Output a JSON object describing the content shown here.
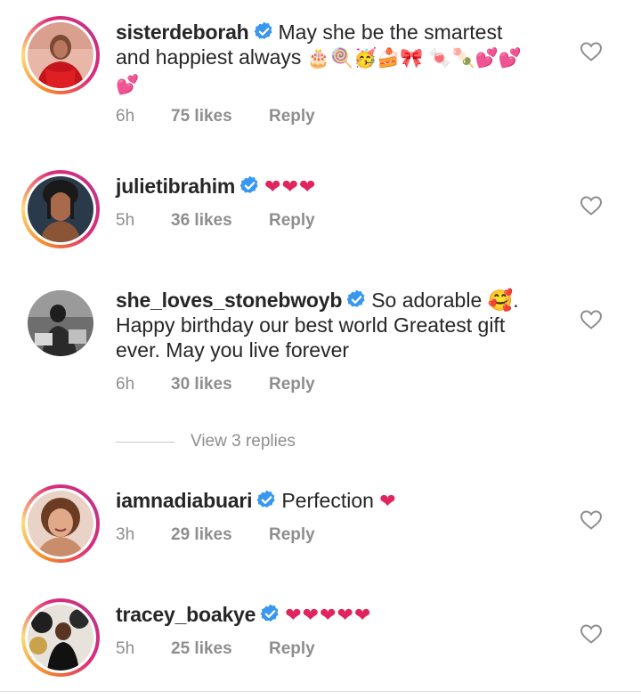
{
  "colors": {
    "text": "#262626",
    "secondary": "#8e8e8e",
    "verified": "#3897f0",
    "heart_red": "#e0245e"
  },
  "comments": [
    {
      "username": "sisterdeborah",
      "verified": true,
      "text": "May she be the smartest and happiest always",
      "emojis": "🎂🍭🥳🍰🎀 🍬🍡💕💕💕",
      "time": "6h",
      "likes": "75 likes",
      "reply": "Reply",
      "avatar_icon": "avatar-red-outfit"
    },
    {
      "username": "julietibrahim",
      "verified": true,
      "text": "",
      "emojis": "❤❤❤",
      "time": "5h",
      "likes": "36 likes",
      "reply": "Reply",
      "avatar_icon": "avatar-portrait"
    },
    {
      "username": "she_loves_stonebwoyb",
      "verified": true,
      "text": "So adorable 🥰. Happy birthday our best world Greatest gift ever. May you live forever",
      "emojis": "",
      "time": "6h",
      "likes": "30 likes",
      "reply": "Reply",
      "avatar_icon": "avatar-bw-photo"
    },
    {
      "username": "iamnadiabuari",
      "verified": true,
      "text": "Perfection",
      "emojis": "❤",
      "time": "3h",
      "likes": "29 likes",
      "reply": "Reply",
      "avatar_icon": "avatar-portrait-smile"
    },
    {
      "username": "tracey_boakye",
      "verified": true,
      "text": "",
      "emojis": "❤❤❤❤❤",
      "time": "5h",
      "likes": "25 likes",
      "reply": "Reply",
      "avatar_icon": "avatar-balloons"
    }
  ],
  "view_replies": "View 3 replies"
}
